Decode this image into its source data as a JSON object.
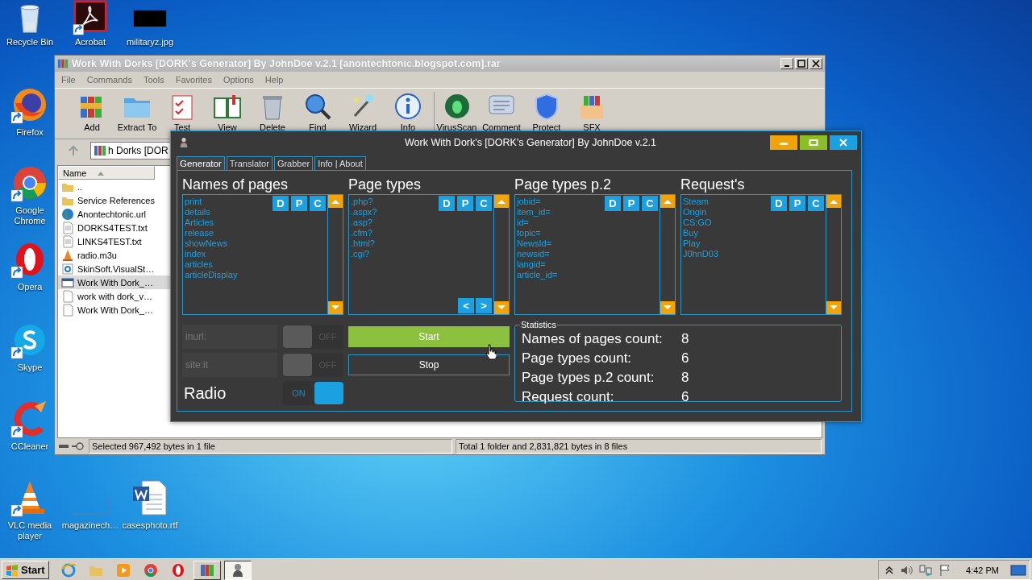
{
  "desktop": {
    "icons": [
      {
        "label": "Recycle Bin"
      },
      {
        "label": "Acrobat"
      },
      {
        "label": "militaryz.jpg"
      },
      {
        "label": "Firefox"
      },
      {
        "label": "Google Chrome"
      },
      {
        "label": "Opera"
      },
      {
        "label": "Skype"
      },
      {
        "label": "CCleaner"
      },
      {
        "label": "VLC media player"
      },
      {
        "label": "magazinech…"
      },
      {
        "label": "casesphoto.rtf"
      }
    ]
  },
  "archive_window": {
    "title": "Work With Dorks [DORK's Generator] By JohnDoe v.2.1 [anontechtonic.blogspot.com].rar",
    "menu": [
      "File",
      "Commands",
      "Tools",
      "Favorites",
      "Options",
      "Help"
    ],
    "toolbar": [
      "Add",
      "Extract To",
      "Test",
      "View",
      "Delete",
      "Find",
      "Wizard",
      "Info",
      "VirusScan",
      "Comment",
      "Protect",
      "SFX"
    ],
    "address": "h Dorks [DOR",
    "columns": [
      "Name"
    ],
    "files": [
      {
        "name": "..",
        "selected": false
      },
      {
        "name": "Service References",
        "selected": false
      },
      {
        "name": "Anontechtonic.url",
        "selected": false
      },
      {
        "name": "DORKS4TEST.txt",
        "selected": false
      },
      {
        "name": "LINKS4TEST.txt",
        "selected": false
      },
      {
        "name": "radio.m3u",
        "selected": false
      },
      {
        "name": "SkinSoft.VisualSt…",
        "selected": false
      },
      {
        "name": "Work With Dork_…",
        "selected": true
      },
      {
        "name": "work with dork_v…",
        "selected": false
      },
      {
        "name": "Work With Dork_…",
        "selected": false
      }
    ],
    "status_left": "Selected 967,492 bytes in 1 file",
    "status_right": "Total 1 folder and 2,831,821 bytes in 8 files"
  },
  "generator_window": {
    "title": "Work With Dork's [DORK's Generator] By JohnDoe v.2.1",
    "tabs": [
      {
        "label": "Generator",
        "selected": true
      },
      {
        "label": "Translator",
        "selected": false
      },
      {
        "label": "Grabber",
        "selected": false
      },
      {
        "label": "Info | About",
        "selected": false
      }
    ],
    "lists": [
      {
        "title": "Names of pages",
        "actions": [
          "D",
          "P",
          "C"
        ],
        "items": [
          "print",
          "details",
          "Articles",
          "release",
          "showNews",
          "index",
          "articles",
          "articleDisplay"
        ]
      },
      {
        "title": "Page types",
        "actions": [
          "D",
          "P",
          "C"
        ],
        "items": [
          ".php?",
          ".aspx?",
          ".asp?",
          ".cfm?",
          ".html?",
          ".cgi?"
        ],
        "pager": [
          "<",
          ">"
        ]
      },
      {
        "title": "Page types p.2",
        "actions": [
          "D",
          "P",
          "C"
        ],
        "items": [
          "jobid=",
          "item_id=",
          "id=",
          "topic=",
          "NewsId=",
          "newsid=",
          "langid=",
          "article_id="
        ]
      },
      {
        "title": "Request's",
        "actions": [
          "D",
          "P",
          "C"
        ],
        "items": [
          "Steam",
          "Origin",
          "CS:GO",
          "Buy",
          "Play",
          "J0hnD03"
        ]
      }
    ],
    "toggles": [
      {
        "kind": "field",
        "label": "inurl:",
        "on": false,
        "state_text": "OFF"
      },
      {
        "kind": "field",
        "label": "site:it",
        "on": false,
        "state_text": "OFF"
      },
      {
        "kind": "heading",
        "label": "Radio",
        "on": true,
        "state_text": "ON"
      }
    ],
    "buttons": [
      {
        "kind": "primary",
        "label": "Start"
      },
      {
        "kind": "outline",
        "label": "Stop"
      }
    ],
    "statistics": {
      "title": "Statistics",
      "rows": [
        {
          "label": "Names of pages count:",
          "value": "8"
        },
        {
          "label": "Page types count:",
          "value": "6"
        },
        {
          "label": "Page types p.2 count:",
          "value": "8"
        },
        {
          "label": "Request count:",
          "value": "6"
        }
      ]
    }
  },
  "taskbar": {
    "start": "Start",
    "apps": [
      {
        "selected": false
      },
      {
        "selected": false
      },
      {
        "selected": false
      },
      {
        "selected": false
      },
      {
        "selected": false
      },
      {
        "selected": false
      },
      {
        "selected": true
      }
    ],
    "clock": "4:42 PM"
  }
}
